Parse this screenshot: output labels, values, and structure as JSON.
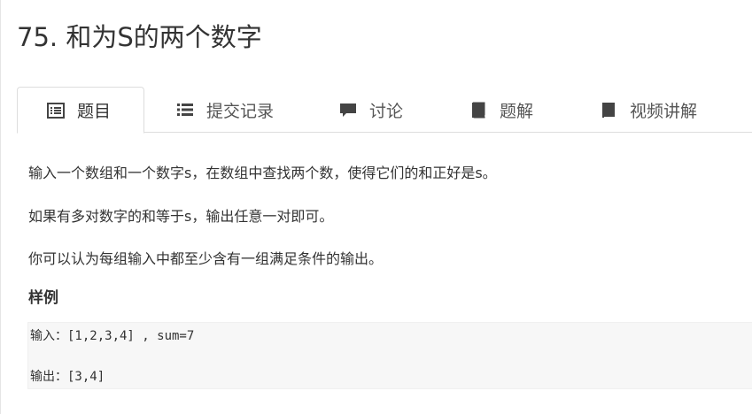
{
  "problem": {
    "title": "75. 和为S的两个数字"
  },
  "tabs": [
    {
      "label": "题目",
      "icon": "list-box-icon",
      "active": true
    },
    {
      "label": "提交记录",
      "icon": "list-icon",
      "active": false
    },
    {
      "label": "讨论",
      "icon": "chat-bubble-icon",
      "active": false
    },
    {
      "label": "题解",
      "icon": "book-icon",
      "active": false
    },
    {
      "label": "视频讲解",
      "icon": "book-icon",
      "active": false
    }
  ],
  "description": {
    "paragraphs": [
      "输入一个数组和一个数字s，在数组中查找两个数，使得它们的和正好是s。",
      "如果有多对数字的和等于s，输出任意一对即可。",
      "你可以认为每组输入中都至少含有一组满足条件的输出。"
    ],
    "sample_heading": "样例",
    "sample_input": "输入：[1,2,3,4] , sum=7",
    "sample_output": "输出：[3,4]"
  },
  "colors": {
    "text": "#333333",
    "tab_text": "#555555",
    "icon": "#444444",
    "border": "#dddddd",
    "sample_bg": "#f7f7f7"
  }
}
